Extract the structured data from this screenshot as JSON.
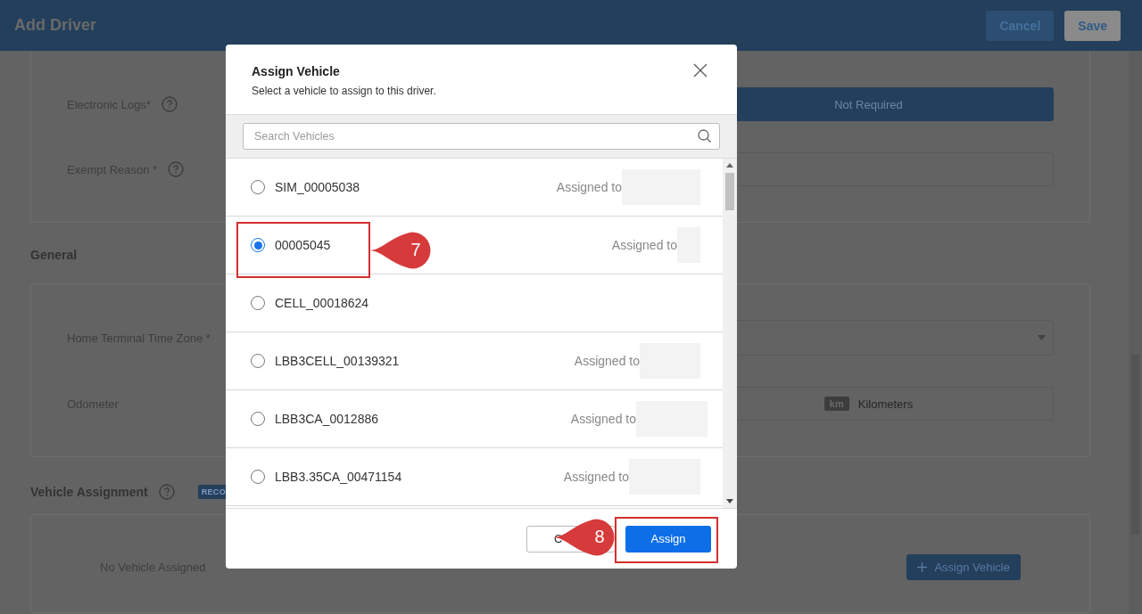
{
  "header": {
    "title": "Add Driver",
    "buttons": [
      "Cancel",
      "Save"
    ]
  },
  "eld_card": {
    "fields": [
      {
        "label": "Electronic Logs*",
        "help": true,
        "kind": "toggle",
        "value": "Not Required"
      },
      {
        "label": "Exempt Reason *",
        "help": true,
        "kind": "text"
      }
    ]
  },
  "general": {
    "heading": "General",
    "fields": [
      {
        "label": "Home Terminal Time Zone *",
        "help": false,
        "kind": "select"
      },
      {
        "label": "Odometer",
        "help": false,
        "kind": "unit",
        "unit": "km",
        "unit_name": "Kilometers"
      }
    ]
  },
  "vehicle_assignment": {
    "heading": "Vehicle Assignment",
    "badge": "RECO",
    "empty_text": "No Vehicle Assigned",
    "button": "Assign Vehicle"
  },
  "modal": {
    "title": "Assign Vehicle",
    "subtitle": "Select a vehicle to assign to this driver.",
    "search_placeholder": "Search Vehicles",
    "vehicles": [
      {
        "name": "SIM_00005038",
        "assigned_label": "Assigned to",
        "selected": false
      },
      {
        "name": "00005045",
        "assigned_label": "Assigned to",
        "selected": true
      },
      {
        "name": "CELL_00018624",
        "selected": false
      },
      {
        "name": "LBB3CELL_00139321",
        "assigned_label": "Assigned to",
        "selected": false
      },
      {
        "name": "LBB3CA_0012886",
        "assigned_label": "Assigned to",
        "selected": false
      },
      {
        "name": "LBB3.35CA_00471154",
        "assigned_label": "Assigned to",
        "selected": false
      }
    ],
    "cancel": "C",
    "assign": "Assign"
  },
  "callouts": [
    {
      "number": "7"
    },
    {
      "number": "8"
    }
  ]
}
